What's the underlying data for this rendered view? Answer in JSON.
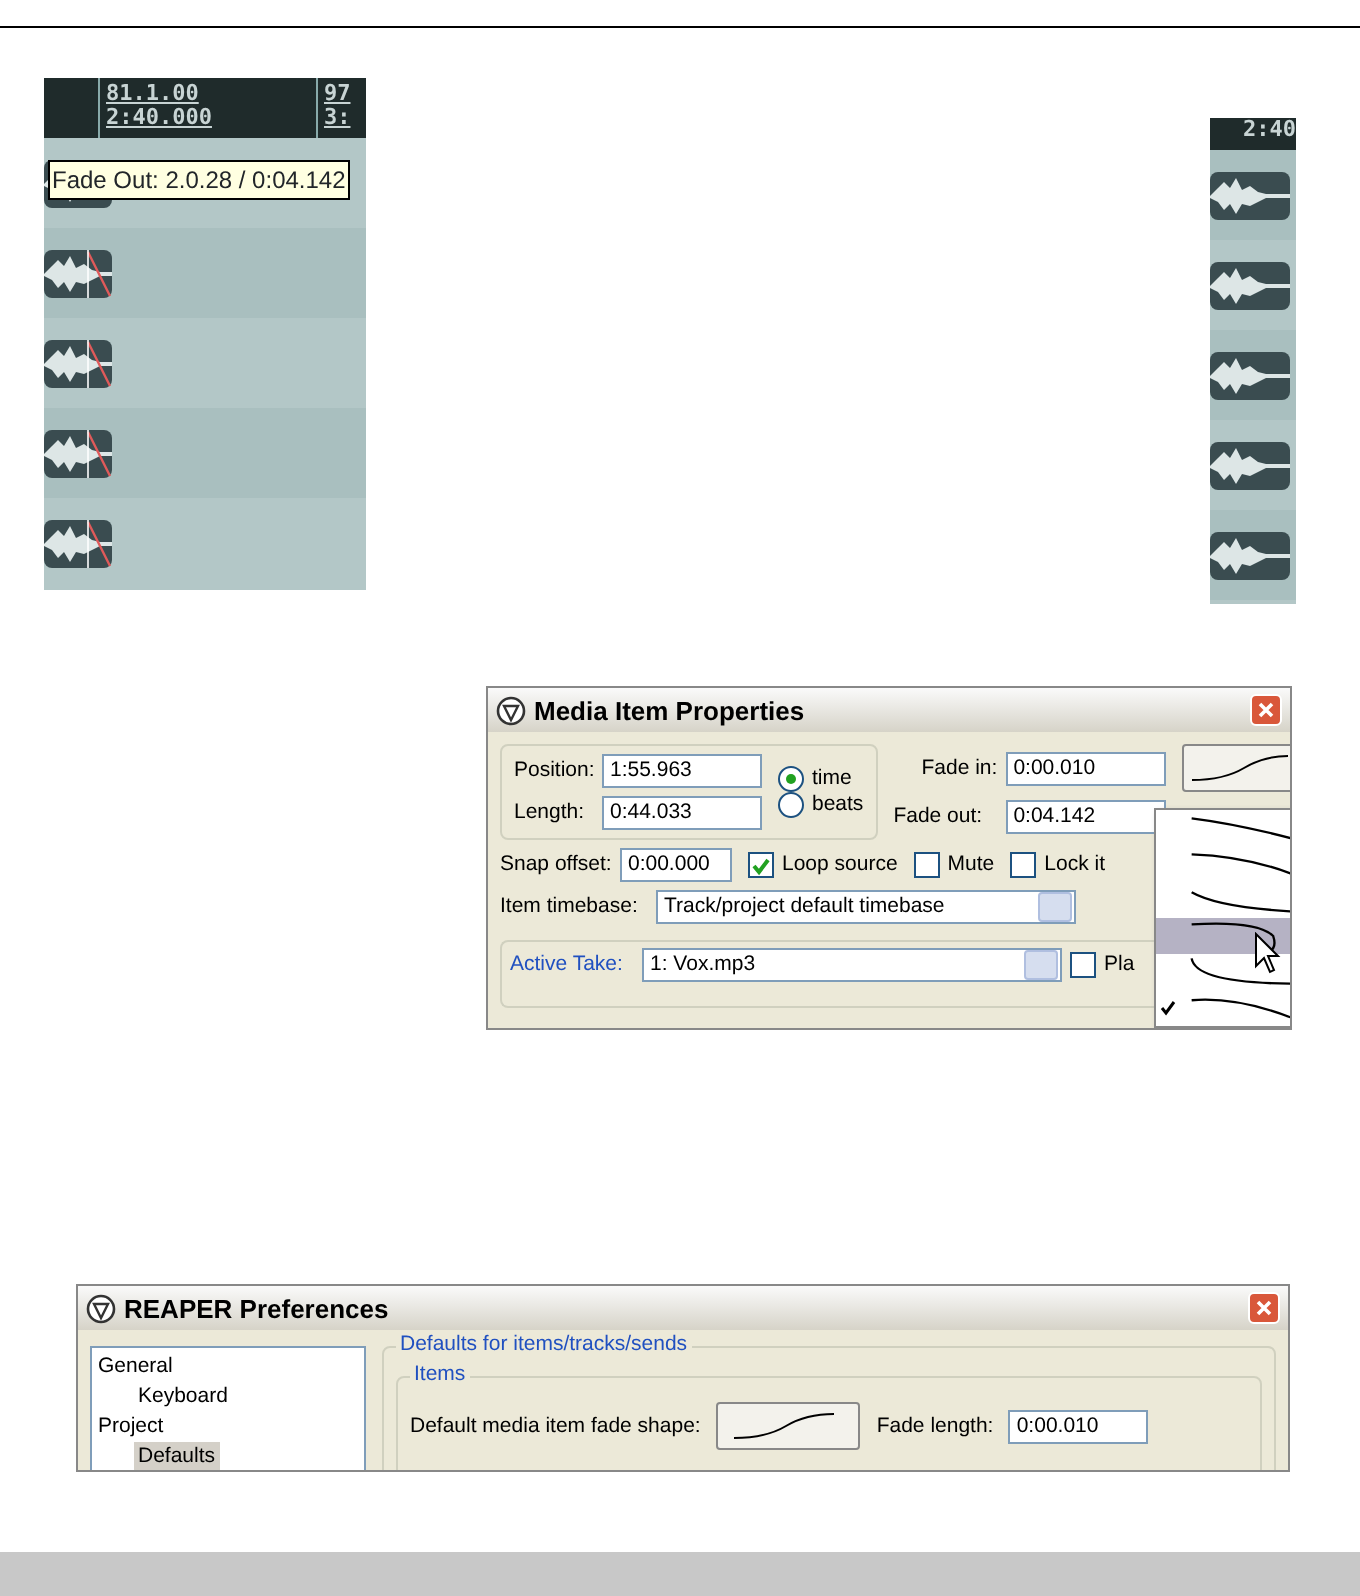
{
  "timeline_left": {
    "ruler": [
      {
        "bar": "81.1.00",
        "time": "2:40.000"
      },
      {
        "bar": "97",
        "time": "3:"
      }
    ],
    "tooltip": "Fade Out: 2.0.28 / 0:04.142",
    "items": [
      {
        "fade_out": false
      },
      {
        "fade_out": true
      },
      {
        "fade_out": true
      },
      {
        "fade_out": true
      },
      {
        "fade_out": true
      }
    ]
  },
  "timeline_right": {
    "ruler": [
      {
        "time": "2:40"
      }
    ],
    "items": [
      {
        "fade_out": false
      },
      {
        "fade_out": false
      },
      {
        "fade_out": false
      },
      {
        "fade_out": false
      },
      {
        "fade_out": false
      }
    ]
  },
  "item_dialog": {
    "title": "Media Item Properties",
    "position_label": "Position:",
    "position": "1:55.963",
    "length_label": "Length:",
    "length": "0:44.033",
    "radios": [
      {
        "label": "time",
        "selected": true
      },
      {
        "label": "beats",
        "selected": false
      }
    ],
    "fade_in_label": "Fade in:",
    "fade_in": "0:00.010",
    "fade_out_label": "Fade out:",
    "fade_out": "0:04.142",
    "fade_shapes": [
      {
        "selected": false,
        "checked": false
      },
      {
        "selected": false,
        "checked": false
      },
      {
        "selected": false,
        "checked": false
      },
      {
        "selected": true,
        "checked": false
      },
      {
        "selected": false,
        "checked": false
      },
      {
        "selected": false,
        "checked": true
      }
    ],
    "snap_label": "Snap offset:",
    "snap": "0:00.000",
    "checkboxes": [
      {
        "label": "Loop source",
        "checked": true
      },
      {
        "label": "Mute",
        "checked": false
      },
      {
        "label": "Lock it",
        "checked": false
      }
    ],
    "timebase_label": "Item timebase:",
    "timebase": "Track/project default timebase",
    "take_group": "Active Take:",
    "take": "1: Vox.mp3",
    "take_checkbox": {
      "label": "Pla",
      "checked": false
    }
  },
  "preferences": {
    "title": "REAPER Preferences",
    "tree": [
      {
        "label": "General",
        "selected": false,
        "children": [
          {
            "label": "Keyboard",
            "selected": false
          }
        ]
      },
      {
        "label": "Project",
        "selected": false,
        "children": [
          {
            "label": "Defaults",
            "selected": true
          }
        ]
      }
    ],
    "group": "Defaults for items/tracks/sends",
    "subgroup": "Items",
    "fade_shape_label": "Default media item fade shape:",
    "fade_length_label": "Fade length:",
    "fade_length": "0:00.010"
  }
}
